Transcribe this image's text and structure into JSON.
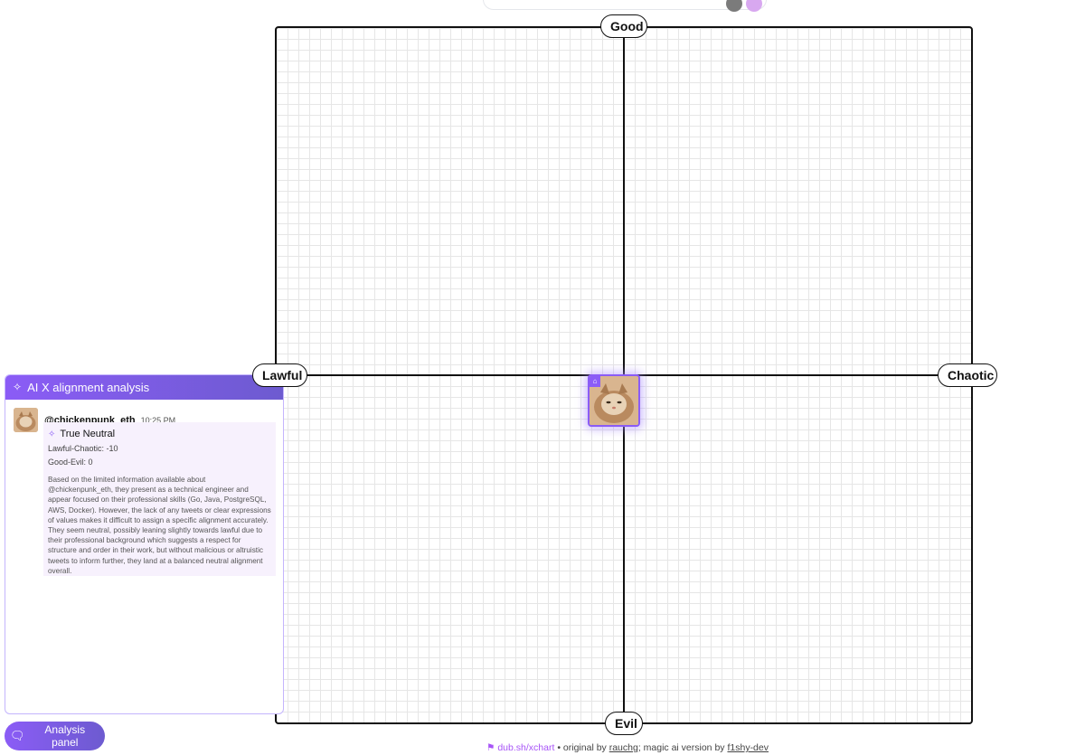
{
  "chart": {
    "axes": {
      "top": "Good",
      "bottom": "Evil",
      "left": "Lawful",
      "right": "Chaotic"
    }
  },
  "panel": {
    "title": "AI X alignment analysis",
    "user": {
      "handle": "@chickenpunk_eth",
      "time": "10:25 PM"
    },
    "result": {
      "alignment": "True Neutral",
      "lawful_chaotic": "Lawful-Chaotic: -10",
      "good_evil": "Good-Evil: 0",
      "description": "Based on the limited information available about @chickenpunk_eth, they present as a technical engineer and appear focused on their professional skills (Go, Java, PostgreSQL, AWS, Docker). However, the lack of any tweets or clear expressions of values makes it difficult to assign a specific alignment accurately. They seem neutral, possibly leaning slightly towards lawful due to their professional background which suggests a respect for structure and order in their work, but without malicious or altruistic tweets to inform further, they land at a balanced neutral alignment overall."
    }
  },
  "button": {
    "label": "Analysis panel"
  },
  "footer": {
    "link": "dub.sh/xchart",
    "sep": "•",
    "original_prefix": "original by",
    "original_author": "rauchg",
    "magic_prefix": "; magic ai version by",
    "magic_author": "f1shy-dev"
  },
  "icons": {
    "sparkle": "sparkle-icon",
    "chat": "chat-bubble-icon",
    "lock": "lock-icon",
    "github": "github-icon"
  },
  "colors": {
    "accent": "#8b5cf6",
    "accent_dark": "#6d5bd0",
    "grid": "#e6e6e6"
  }
}
